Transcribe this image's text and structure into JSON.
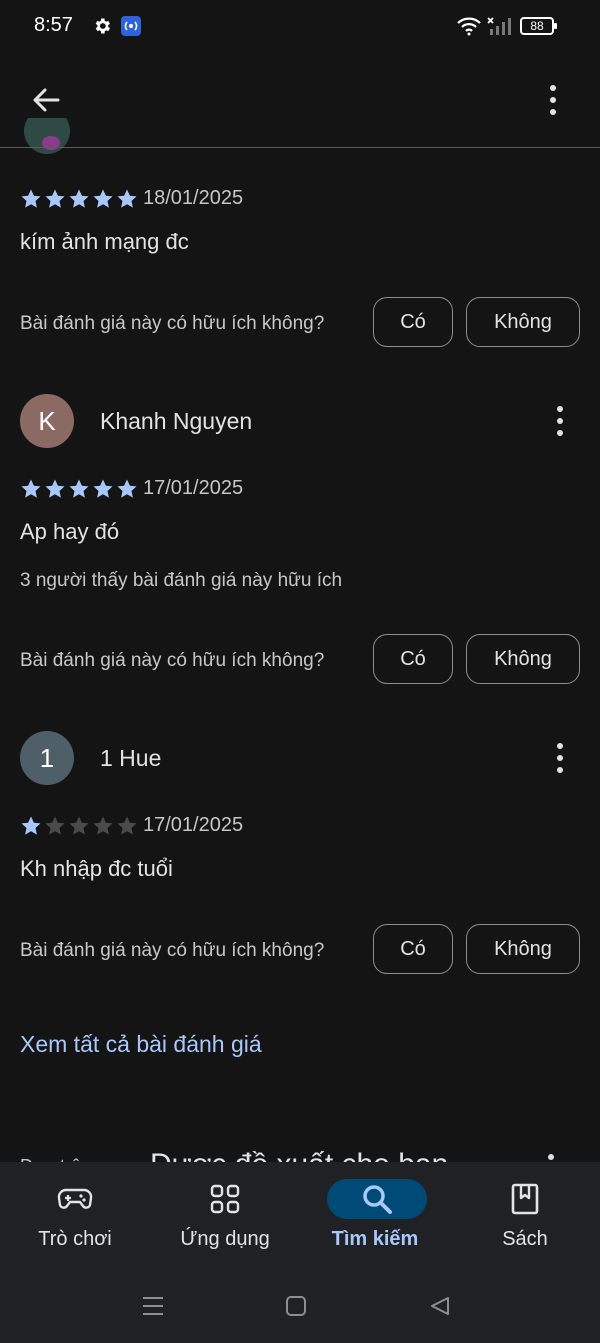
{
  "status_bar": {
    "time": "8:57",
    "battery": "88"
  },
  "reviews": [
    {
      "date": "18/01/2025",
      "rating": 5,
      "text": "kím ảnh mạng đc"
    },
    {
      "name": "Khanh Nguyen",
      "avatar_letter": "K",
      "avatar_color": "#8c6a64",
      "date": "17/01/2025",
      "rating": 5,
      "text": "Ap hay đó",
      "helpful_count_text": "3 người thấy bài đánh giá này hữu ích"
    },
    {
      "name": "1 Hue",
      "avatar_letter": "1",
      "avatar_color": "#4f5f68",
      "date": "17/01/2025",
      "rating": 1,
      "text": "Kh nhập đc tuổi"
    }
  ],
  "helpful": {
    "question": "Bài đánh giá này có hữu ích không?",
    "yes": "Có",
    "no": "Không"
  },
  "see_all": "Xem tất cả bài đánh giá",
  "next_section": {
    "small": "Dựa trên",
    "title": "Được đề xuất cho bạn"
  },
  "bottom_nav": [
    {
      "label": "Trò chơi",
      "icon": "gamepad-icon",
      "active": false
    },
    {
      "label": "Ứng dụng",
      "icon": "apps-grid-icon",
      "active": false
    },
    {
      "label": "Tìm kiếm",
      "icon": "search-icon",
      "active": true
    },
    {
      "label": "Sách",
      "icon": "book-icon",
      "active": false
    }
  ],
  "colors": {
    "accent": "#a8c7fa",
    "star": "#a8c7fa",
    "background": "#141414"
  }
}
